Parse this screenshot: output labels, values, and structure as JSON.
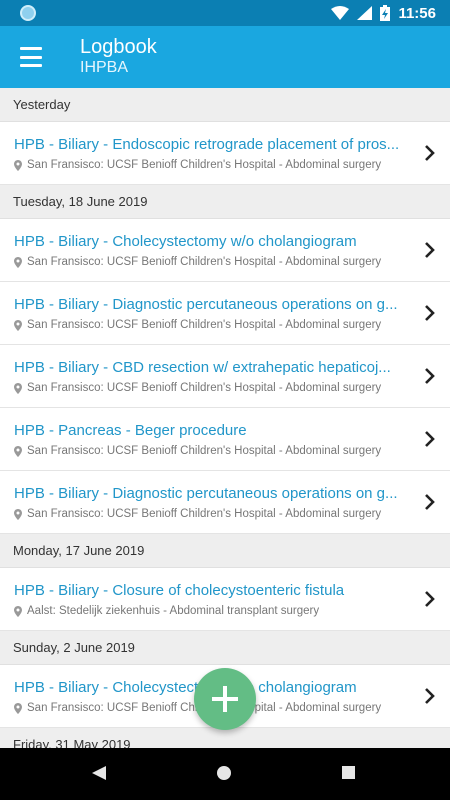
{
  "status_bar": {
    "time": "11:56",
    "battery": "charging"
  },
  "app_bar": {
    "title": "Logbook",
    "subtitle": "IHPBA",
    "menu_icon": "hamburger-menu-icon"
  },
  "sections": [
    {
      "header": "Yesterday",
      "entries": [
        {
          "title": "HPB - Biliary - Endoscopic retrograde placement of pros...",
          "location": "San Fransisco: UCSF Benioff Children's Hospital - Abdominal surgery"
        }
      ]
    },
    {
      "header": "Tuesday, 18 June 2019",
      "entries": [
        {
          "title": "HPB - Biliary - Cholecystectomy w/o  cholangiogram",
          "location": "San Fransisco: UCSF Benioff Children's Hospital - Abdominal surgery"
        },
        {
          "title": "HPB - Biliary - Diagnostic percutaneous operations on g...",
          "location": "San Fransisco: UCSF Benioff Children's Hospital - Abdominal surgery"
        },
        {
          "title": "HPB - Biliary - CBD resection w/ extrahepatic  hepaticoj...",
          "location": "San Fransisco: UCSF Benioff Children's Hospital - Abdominal surgery"
        },
        {
          "title": "HPB - Pancreas - Beger procedure",
          "location": "San Fransisco: UCSF Benioff Children's Hospital - Abdominal surgery"
        },
        {
          "title": "HPB - Biliary - Diagnostic percutaneous operations on g...",
          "location": "San Fransisco: UCSF Benioff Children's Hospital - Abdominal surgery"
        }
      ]
    },
    {
      "header": "Monday, 17 June 2019",
      "entries": [
        {
          "title": "HPB - Biliary - Closure of cholecystoenteric fistula",
          "location": "Aalst: Stedelijk ziekenhuis - Abdominal transplant surgery"
        }
      ]
    },
    {
      "header": "Sunday, 2 June 2019",
      "entries": [
        {
          "title": "HPB - Biliary - Cholecystectomy w/o  cholangiogram",
          "location": "San Fransisco: UCSF Benioff Children's Hospital - Abdominal surgery"
        }
      ]
    },
    {
      "header": "Friday, 31 May 2019",
      "entries": []
    }
  ],
  "fab": {
    "icon": "plus-icon"
  },
  "colors": {
    "status_bar": "#0b7fb3",
    "app_bar": "#1aa7e0",
    "entry_title": "#2196c9",
    "fab": "#63bd85"
  }
}
